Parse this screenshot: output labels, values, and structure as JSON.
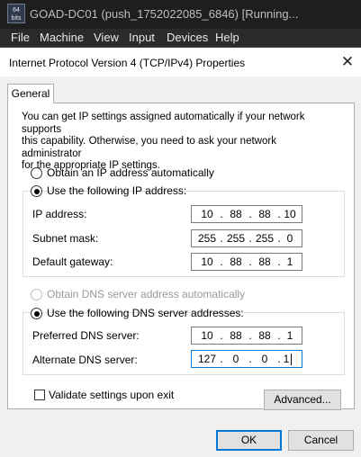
{
  "vm_window": {
    "logo_text": "64\nbits",
    "title": "GOAD-DC01 (push_1752022085_6846) [Running..."
  },
  "vm_menu": [
    "File",
    "Machine",
    "View",
    "Input",
    "Devices",
    "Help"
  ],
  "dialog": {
    "title": "Internet Protocol Version 4 (TCP/IPv4) Properties",
    "close_glyph": "✕",
    "tab": "General",
    "intro": "You can get IP settings assigned automatically if your network supports\nthis capability. Otherwise, you need to ask your network administrator\nfor the appropriate IP settings.",
    "ip_auto_label": "Obtain an IP address automatically",
    "ip_manual_label": "Use the following IP address:",
    "ip_fields": [
      {
        "label": "IP address:",
        "octets": [
          "10",
          "88",
          "88",
          "10"
        ]
      },
      {
        "label": "Subnet mask:",
        "octets": [
          "255",
          "255",
          "255",
          "0"
        ]
      },
      {
        "label": "Default gateway:",
        "octets": [
          "10",
          "88",
          "88",
          "1"
        ]
      }
    ],
    "dns_auto_label": "Obtain DNS server address automatically",
    "dns_manual_label": "Use the following DNS server addresses:",
    "dns_fields": [
      {
        "label": "Preferred DNS server:",
        "octets": [
          "10",
          "88",
          "88",
          "1"
        ]
      },
      {
        "label": "Alternate DNS server:",
        "octets": [
          "127",
          "0",
          "0",
          "1"
        ]
      }
    ],
    "validate_label": "Validate settings upon exit",
    "advanced_label": "Advanced...",
    "ok_label": "OK",
    "cancel_label": "Cancel"
  }
}
